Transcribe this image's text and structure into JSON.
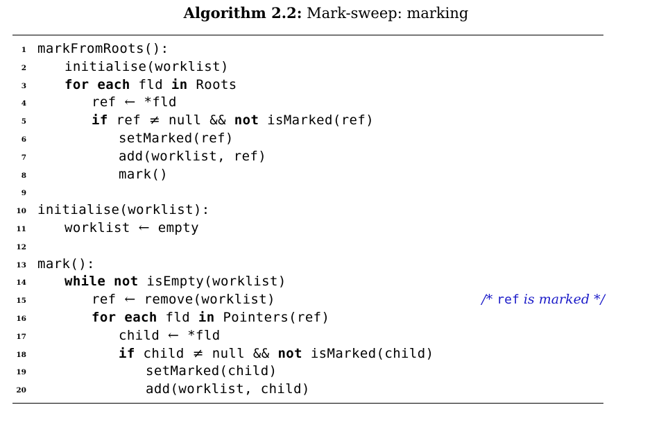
{
  "caption": {
    "label": "Algorithm 2.2:",
    "title": " Mark-sweep: marking"
  },
  "lines": [
    {
      "no": "1",
      "indent": 0,
      "tokens": [
        {
          "t": "markFromRoots():"
        }
      ]
    },
    {
      "no": "2",
      "indent": 1,
      "tokens": [
        {
          "t": "initialise(worklist)"
        }
      ]
    },
    {
      "no": "3",
      "indent": 1,
      "tokens": [
        {
          "t": "for each",
          "k": true
        },
        {
          "t": " fld "
        },
        {
          "t": "in",
          "k": true
        },
        {
          "t": " Roots"
        }
      ]
    },
    {
      "no": "4",
      "indent": 2,
      "tokens": [
        {
          "t": "ref "
        },
        {
          "t": "←",
          "o": true
        },
        {
          "t": " *fld"
        }
      ]
    },
    {
      "no": "5",
      "indent": 2,
      "tokens": [
        {
          "t": "if",
          "k": true
        },
        {
          "t": " ref "
        },
        {
          "t": "≠",
          "o": true
        },
        {
          "t": " null && "
        },
        {
          "t": "not",
          "k": true
        },
        {
          "t": " isMarked(ref)"
        }
      ]
    },
    {
      "no": "6",
      "indent": 3,
      "tokens": [
        {
          "t": "setMarked(ref)"
        }
      ]
    },
    {
      "no": "7",
      "indent": 3,
      "tokens": [
        {
          "t": "add(worklist, ref)"
        }
      ]
    },
    {
      "no": "8",
      "indent": 3,
      "tokens": [
        {
          "t": "mark()"
        }
      ]
    },
    {
      "no": "9",
      "indent": 0,
      "tokens": []
    },
    {
      "no": "10",
      "indent": 0,
      "tokens": [
        {
          "t": "initialise(worklist):"
        }
      ]
    },
    {
      "no": "11",
      "indent": 1,
      "tokens": [
        {
          "t": "worklist "
        },
        {
          "t": "←",
          "o": true
        },
        {
          "t": " empty"
        }
      ]
    },
    {
      "no": "12",
      "indent": 0,
      "tokens": []
    },
    {
      "no": "13",
      "indent": 0,
      "tokens": [
        {
          "t": "mark():"
        }
      ]
    },
    {
      "no": "14",
      "indent": 1,
      "tokens": [
        {
          "t": "while not",
          "k": true
        },
        {
          "t": " isEmpty(worklist)"
        }
      ]
    },
    {
      "no": "15",
      "indent": 2,
      "tokens": [
        {
          "t": "ref "
        },
        {
          "t": "←",
          "o": true
        },
        {
          "t": " remove(worklist)"
        }
      ],
      "comment": {
        "open": "/* ",
        "code": "ref",
        "text": " is marked ",
        "close": "*/"
      }
    },
    {
      "no": "16",
      "indent": 2,
      "tokens": [
        {
          "t": "for each",
          "k": true
        },
        {
          "t": " fld "
        },
        {
          "t": "in",
          "k": true
        },
        {
          "t": " Pointers(ref)"
        }
      ]
    },
    {
      "no": "17",
      "indent": 3,
      "tokens": [
        {
          "t": "child "
        },
        {
          "t": "←",
          "o": true
        },
        {
          "t": " *fld"
        }
      ]
    },
    {
      "no": "18",
      "indent": 3,
      "tokens": [
        {
          "t": "if",
          "k": true
        },
        {
          "t": " child "
        },
        {
          "t": "≠",
          "o": true
        },
        {
          "t": " null && "
        },
        {
          "t": "not",
          "k": true
        },
        {
          "t": " isMarked(child)"
        }
      ]
    },
    {
      "no": "19",
      "indent": 4,
      "tokens": [
        {
          "t": "setMarked(child)"
        }
      ]
    },
    {
      "no": "20",
      "indent": 4,
      "tokens": [
        {
          "t": "add(worklist, child)"
        }
      ]
    }
  ],
  "colors": {
    "comment": "#1a1ac8",
    "text": "#000000",
    "rule": "#000000"
  }
}
